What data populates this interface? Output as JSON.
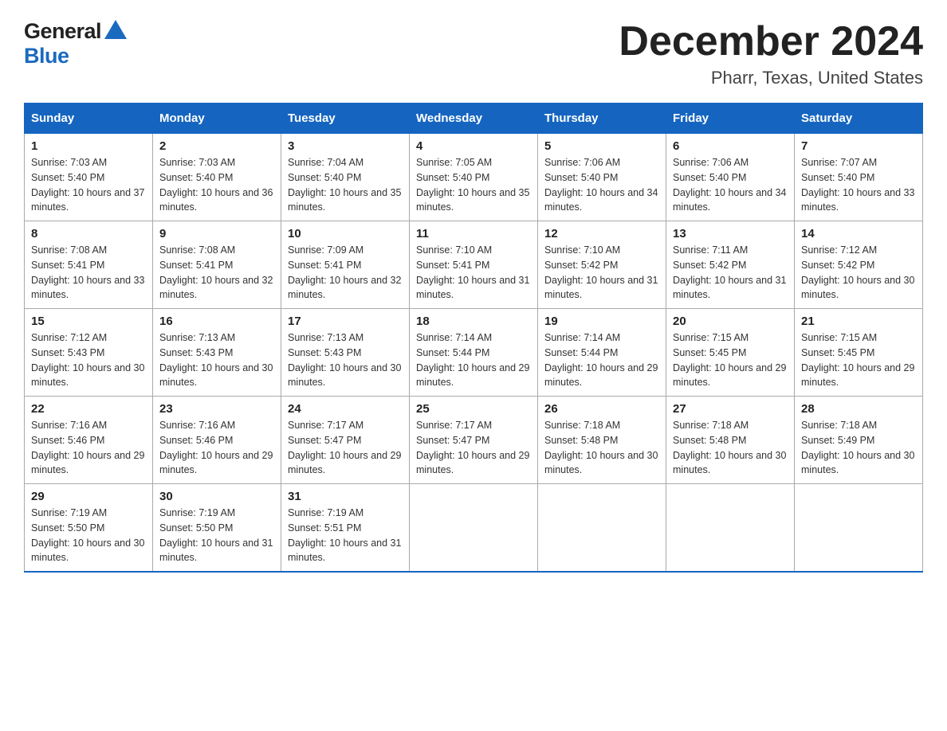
{
  "logo": {
    "general": "General",
    "blue": "Blue"
  },
  "title": "December 2024",
  "subtitle": "Pharr, Texas, United States",
  "days_of_week": [
    "Sunday",
    "Monday",
    "Tuesday",
    "Wednesday",
    "Thursday",
    "Friday",
    "Saturday"
  ],
  "weeks": [
    [
      {
        "day": "1",
        "sunrise": "7:03 AM",
        "sunset": "5:40 PM",
        "daylight": "10 hours and 37 minutes."
      },
      {
        "day": "2",
        "sunrise": "7:03 AM",
        "sunset": "5:40 PM",
        "daylight": "10 hours and 36 minutes."
      },
      {
        "day": "3",
        "sunrise": "7:04 AM",
        "sunset": "5:40 PM",
        "daylight": "10 hours and 35 minutes."
      },
      {
        "day": "4",
        "sunrise": "7:05 AM",
        "sunset": "5:40 PM",
        "daylight": "10 hours and 35 minutes."
      },
      {
        "day": "5",
        "sunrise": "7:06 AM",
        "sunset": "5:40 PM",
        "daylight": "10 hours and 34 minutes."
      },
      {
        "day": "6",
        "sunrise": "7:06 AM",
        "sunset": "5:40 PM",
        "daylight": "10 hours and 34 minutes."
      },
      {
        "day": "7",
        "sunrise": "7:07 AM",
        "sunset": "5:40 PM",
        "daylight": "10 hours and 33 minutes."
      }
    ],
    [
      {
        "day": "8",
        "sunrise": "7:08 AM",
        "sunset": "5:41 PM",
        "daylight": "10 hours and 33 minutes."
      },
      {
        "day": "9",
        "sunrise": "7:08 AM",
        "sunset": "5:41 PM",
        "daylight": "10 hours and 32 minutes."
      },
      {
        "day": "10",
        "sunrise": "7:09 AM",
        "sunset": "5:41 PM",
        "daylight": "10 hours and 32 minutes."
      },
      {
        "day": "11",
        "sunrise": "7:10 AM",
        "sunset": "5:41 PM",
        "daylight": "10 hours and 31 minutes."
      },
      {
        "day": "12",
        "sunrise": "7:10 AM",
        "sunset": "5:42 PM",
        "daylight": "10 hours and 31 minutes."
      },
      {
        "day": "13",
        "sunrise": "7:11 AM",
        "sunset": "5:42 PM",
        "daylight": "10 hours and 31 minutes."
      },
      {
        "day": "14",
        "sunrise": "7:12 AM",
        "sunset": "5:42 PM",
        "daylight": "10 hours and 30 minutes."
      }
    ],
    [
      {
        "day": "15",
        "sunrise": "7:12 AM",
        "sunset": "5:43 PM",
        "daylight": "10 hours and 30 minutes."
      },
      {
        "day": "16",
        "sunrise": "7:13 AM",
        "sunset": "5:43 PM",
        "daylight": "10 hours and 30 minutes."
      },
      {
        "day": "17",
        "sunrise": "7:13 AM",
        "sunset": "5:43 PM",
        "daylight": "10 hours and 30 minutes."
      },
      {
        "day": "18",
        "sunrise": "7:14 AM",
        "sunset": "5:44 PM",
        "daylight": "10 hours and 29 minutes."
      },
      {
        "day": "19",
        "sunrise": "7:14 AM",
        "sunset": "5:44 PM",
        "daylight": "10 hours and 29 minutes."
      },
      {
        "day": "20",
        "sunrise": "7:15 AM",
        "sunset": "5:45 PM",
        "daylight": "10 hours and 29 minutes."
      },
      {
        "day": "21",
        "sunrise": "7:15 AM",
        "sunset": "5:45 PM",
        "daylight": "10 hours and 29 minutes."
      }
    ],
    [
      {
        "day": "22",
        "sunrise": "7:16 AM",
        "sunset": "5:46 PM",
        "daylight": "10 hours and 29 minutes."
      },
      {
        "day": "23",
        "sunrise": "7:16 AM",
        "sunset": "5:46 PM",
        "daylight": "10 hours and 29 minutes."
      },
      {
        "day": "24",
        "sunrise": "7:17 AM",
        "sunset": "5:47 PM",
        "daylight": "10 hours and 29 minutes."
      },
      {
        "day": "25",
        "sunrise": "7:17 AM",
        "sunset": "5:47 PM",
        "daylight": "10 hours and 29 minutes."
      },
      {
        "day": "26",
        "sunrise": "7:18 AM",
        "sunset": "5:48 PM",
        "daylight": "10 hours and 30 minutes."
      },
      {
        "day": "27",
        "sunrise": "7:18 AM",
        "sunset": "5:48 PM",
        "daylight": "10 hours and 30 minutes."
      },
      {
        "day": "28",
        "sunrise": "7:18 AM",
        "sunset": "5:49 PM",
        "daylight": "10 hours and 30 minutes."
      }
    ],
    [
      {
        "day": "29",
        "sunrise": "7:19 AM",
        "sunset": "5:50 PM",
        "daylight": "10 hours and 30 minutes."
      },
      {
        "day": "30",
        "sunrise": "7:19 AM",
        "sunset": "5:50 PM",
        "daylight": "10 hours and 31 minutes."
      },
      {
        "day": "31",
        "sunrise": "7:19 AM",
        "sunset": "5:51 PM",
        "daylight": "10 hours and 31 minutes."
      },
      null,
      null,
      null,
      null
    ]
  ]
}
